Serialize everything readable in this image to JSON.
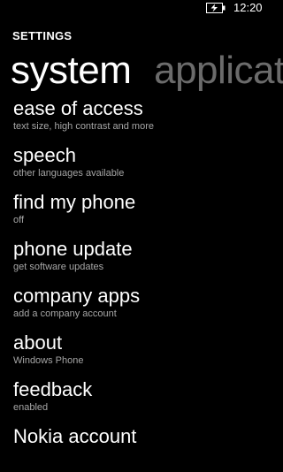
{
  "status_bar": {
    "time": "12:20",
    "battery_icon": "battery-charging-icon"
  },
  "header": {
    "app_title": "SETTINGS"
  },
  "pivot": {
    "tabs": [
      {
        "label": "system",
        "active": true
      },
      {
        "label": "applicat",
        "active": false
      }
    ]
  },
  "settings": {
    "items": [
      {
        "title": "ease of access",
        "subtitle": "text size, high contrast and more"
      },
      {
        "title": "speech",
        "subtitle": "other languages available"
      },
      {
        "title": "find my phone",
        "subtitle": "off"
      },
      {
        "title": "phone update",
        "subtitle": "get software updates"
      },
      {
        "title": "company apps",
        "subtitle": "add a company account"
      },
      {
        "title": "about",
        "subtitle": "Windows Phone"
      },
      {
        "title": "feedback",
        "subtitle": "enabled"
      },
      {
        "title": "Nokia account",
        "subtitle": ""
      }
    ]
  },
  "colors": {
    "background": "#000000",
    "text": "#ffffff",
    "subtext": "#a6a6a6",
    "inactive_tab": "#6b6b6b"
  }
}
